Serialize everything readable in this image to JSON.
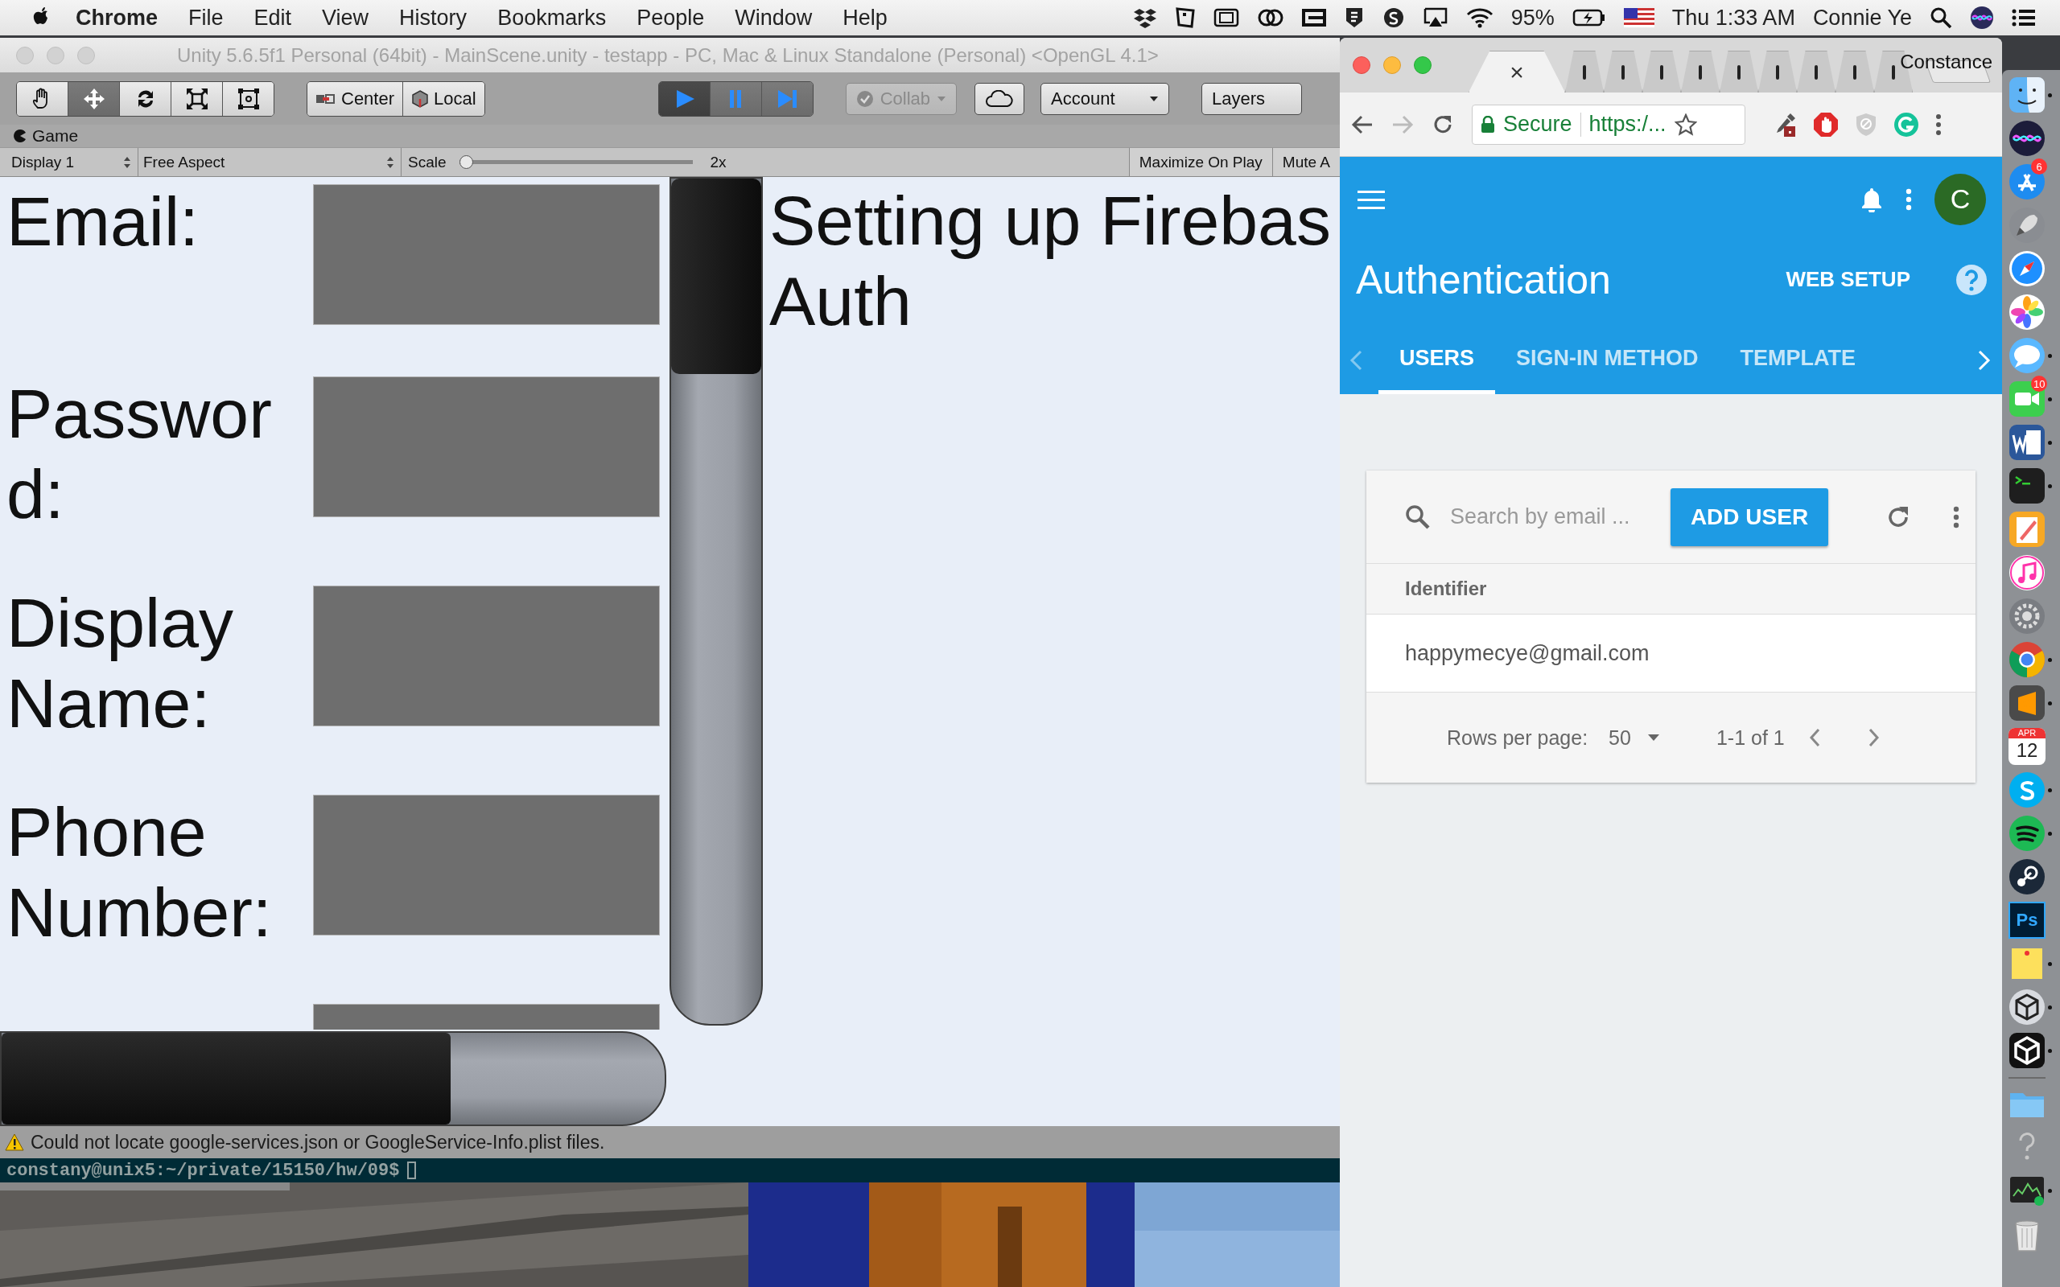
{
  "menu_bar": {
    "app": "Chrome",
    "items": [
      "File",
      "Edit",
      "View",
      "History",
      "Bookmarks",
      "People",
      "Window",
      "Help"
    ],
    "battery": "95%",
    "clock": "Thu 1:33 AM",
    "user": "Connie Ye"
  },
  "unity": {
    "title": "Unity 5.6.5f1 Personal (64bit) - MainScene.unity - testapp - PC, Mac & Linux Standalone (Personal) <OpenGL 4.1>",
    "tools": [
      {
        "kind": "hand",
        "selected": false
      },
      {
        "kind": "move",
        "selected": true
      },
      {
        "kind": "rotate",
        "selected": false
      },
      {
        "kind": "scale",
        "selected": false
      },
      {
        "kind": "rect",
        "selected": false
      }
    ],
    "pivot": [
      {
        "kind": "center",
        "label": "Center"
      },
      {
        "kind": "local",
        "label": "Local"
      }
    ],
    "playback": [
      {
        "kind": "play",
        "on": true
      },
      {
        "kind": "pause",
        "on": false
      },
      {
        "kind": "step",
        "on": false
      }
    ],
    "collab": {
      "label": "Collab",
      "disabled": true
    },
    "account": "Account",
    "layers": "Layers",
    "game_tab": "Game",
    "display": "Display 1",
    "aspect": "Free Aspect",
    "scale": {
      "label": "Scale",
      "level": 0,
      "value": "2x"
    },
    "maximize": "Maximize On Play",
    "mute": "Mute A",
    "game": {
      "fields": [
        {
          "kind": "labeled",
          "label": "Email:"
        },
        {
          "kind": "labeled",
          "label": "Password:"
        },
        {
          "kind": "labeled",
          "label": "Display Name:"
        },
        {
          "kind": "labeled",
          "label": "Phone Number:"
        },
        {
          "kind": "cut"
        }
      ],
      "heading": [
        "Setting up Firebas",
        "Auth"
      ]
    },
    "console": "Could not locate google-services.json or GoogleService-Info.plist files."
  },
  "terminal": {
    "prompt": "constany@unix5:~/private/15150/hw/09$"
  },
  "chrome": {
    "tabs": [
      {
        "selected": true,
        "close": "×"
      },
      {
        "selected": false
      },
      {
        "selected": false
      },
      {
        "selected": false
      },
      {
        "selected": false
      },
      {
        "selected": false
      },
      {
        "selected": false
      },
      {
        "selected": false
      },
      {
        "selected": false
      },
      {
        "selected": false
      }
    ],
    "profile": "Constance",
    "secure": "Secure",
    "url": "https:/...",
    "page": {
      "title": "Authentication",
      "web_setup": "WEB SETUP",
      "avatar": "C",
      "tabs": [
        {
          "label": "USERS",
          "selected": true
        },
        {
          "label": "SIGN-IN METHOD",
          "selected": false
        },
        {
          "label": "TEMPLATE",
          "selected": false
        }
      ],
      "search": {
        "placeholder": "Search by email ..."
      },
      "add_user": "ADD USER",
      "table": {
        "columns": [
          "Identifier"
        ],
        "rows": [
          "happymecye@gmail.com"
        ]
      },
      "rows_per_page": "Rows per page:",
      "page_size": "50",
      "range": "1-1 of 1"
    }
  },
  "dock": [
    {
      "kind": "finder",
      "running": true
    },
    {
      "kind": "siri",
      "running": false
    },
    {
      "kind": "appstore",
      "running": false,
      "badge": "6"
    },
    {
      "kind": "launchpad",
      "running": false
    },
    {
      "kind": "safari",
      "running": false
    },
    {
      "kind": "photos",
      "running": false
    },
    {
      "kind": "messages",
      "running": true
    },
    {
      "kind": "facetime",
      "running": true,
      "badge": "10"
    },
    {
      "kind": "word",
      "running": true
    },
    {
      "kind": "terminal",
      "running": true
    },
    {
      "kind": "pages",
      "running": false
    },
    {
      "kind": "music",
      "running": false
    },
    {
      "kind": "settings",
      "running": false
    },
    {
      "kind": "chrome",
      "running": true
    },
    {
      "kind": "sublime",
      "running": true
    },
    {
      "kind": "calendar",
      "running": false,
      "month": "APR",
      "day": "12"
    },
    {
      "kind": "skype",
      "running": true
    },
    {
      "kind": "spotify",
      "running": true
    },
    {
      "kind": "steam",
      "running": false
    },
    {
      "kind": "photoshop",
      "running": false,
      "glyph": "Ps"
    },
    {
      "kind": "notes",
      "running": true
    },
    {
      "kind": "unityhub",
      "running": true
    },
    {
      "kind": "unity",
      "running": true
    },
    {
      "kind": "separator"
    },
    {
      "kind": "folder",
      "running": false
    },
    {
      "kind": "help",
      "running": false
    },
    {
      "kind": "monitor",
      "running": true
    },
    {
      "kind": "trash",
      "running": false
    }
  ]
}
